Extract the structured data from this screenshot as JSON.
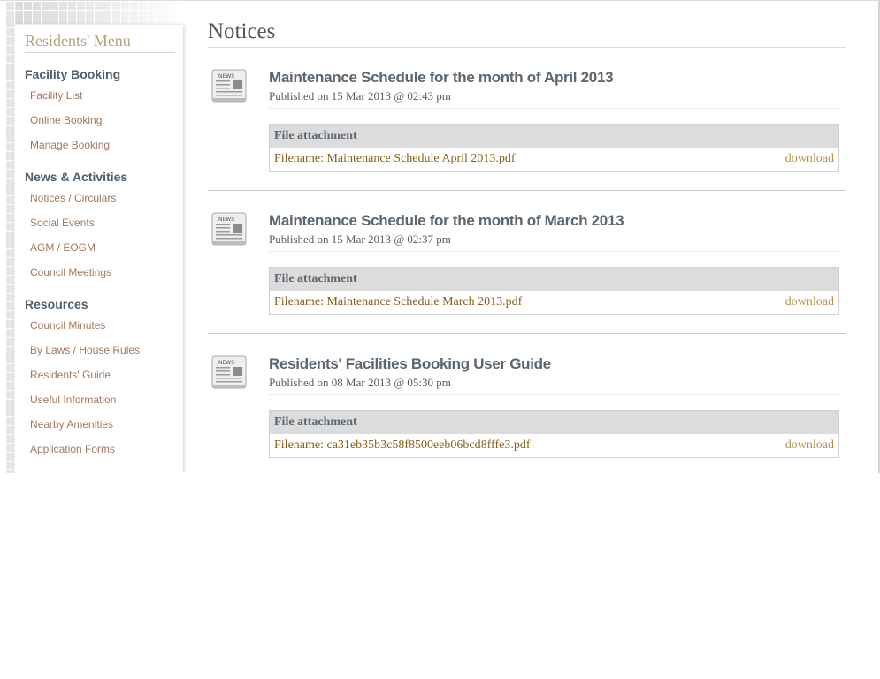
{
  "sidebar": {
    "title": "Residents' Menu",
    "sections": [
      {
        "heading": "Facility Booking",
        "items": [
          "Facility List",
          "Online Booking",
          "Manage Booking"
        ]
      },
      {
        "heading": "News & Activities",
        "items": [
          "Notices / Circulars",
          "Social Events",
          "AGM / EOGM",
          "Council Meetings"
        ]
      },
      {
        "heading": "Resources",
        "items": [
          "Council Minutes",
          "By Laws / House Rules",
          "Residents' Guide",
          "Useful Information",
          "Nearby Amenities",
          "Application Forms"
        ]
      }
    ]
  },
  "main": {
    "title": "Notices",
    "notices": [
      {
        "title": "Maintenance Schedule for the month of April 2013",
        "published": "Published on 15 Mar 2013 @ 02:43 pm",
        "attachment_header": "File attachment",
        "filename": "Filename: Maintenance Schedule April 2013.pdf",
        "download": "download"
      },
      {
        "title": "Maintenance Schedule for the month of March 2013",
        "published": "Published on 15 Mar 2013 @ 02:37 pm",
        "attachment_header": "File attachment",
        "filename": "Filename: Maintenance Schedule March 2013.pdf",
        "download": "download"
      },
      {
        "title": "Residents' Facilities Booking User Guide",
        "published": "Published on 08 Mar 2013 @ 05:30 pm",
        "attachment_header": "File attachment",
        "filename": "Filename: ca31eb35b3c58f8500eeb06bcd8fffe3.pdf",
        "download": "download"
      }
    ]
  },
  "icons": {
    "notice_icon": "news-icon",
    "news_icon_text": "NEWS"
  },
  "colors": {
    "menu_title": "#b4a27c",
    "menu_heading": "#4f5f6c",
    "menu_link": "#a5785d",
    "notice_title": "#5a6670",
    "filename": "#8a6018",
    "download": "#b8914a"
  }
}
